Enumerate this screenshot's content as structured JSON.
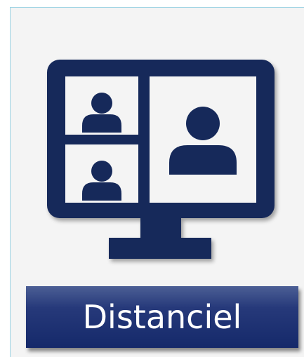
{
  "card": {
    "icon": "video-conference-monitor-icon",
    "label": "Distanciel"
  },
  "colors": {
    "icon": "#16295a",
    "label_background": "#1d3172",
    "label_text": "#ffffff",
    "card_background": "#f4f4f4",
    "card_border": "#9dd3e3"
  }
}
